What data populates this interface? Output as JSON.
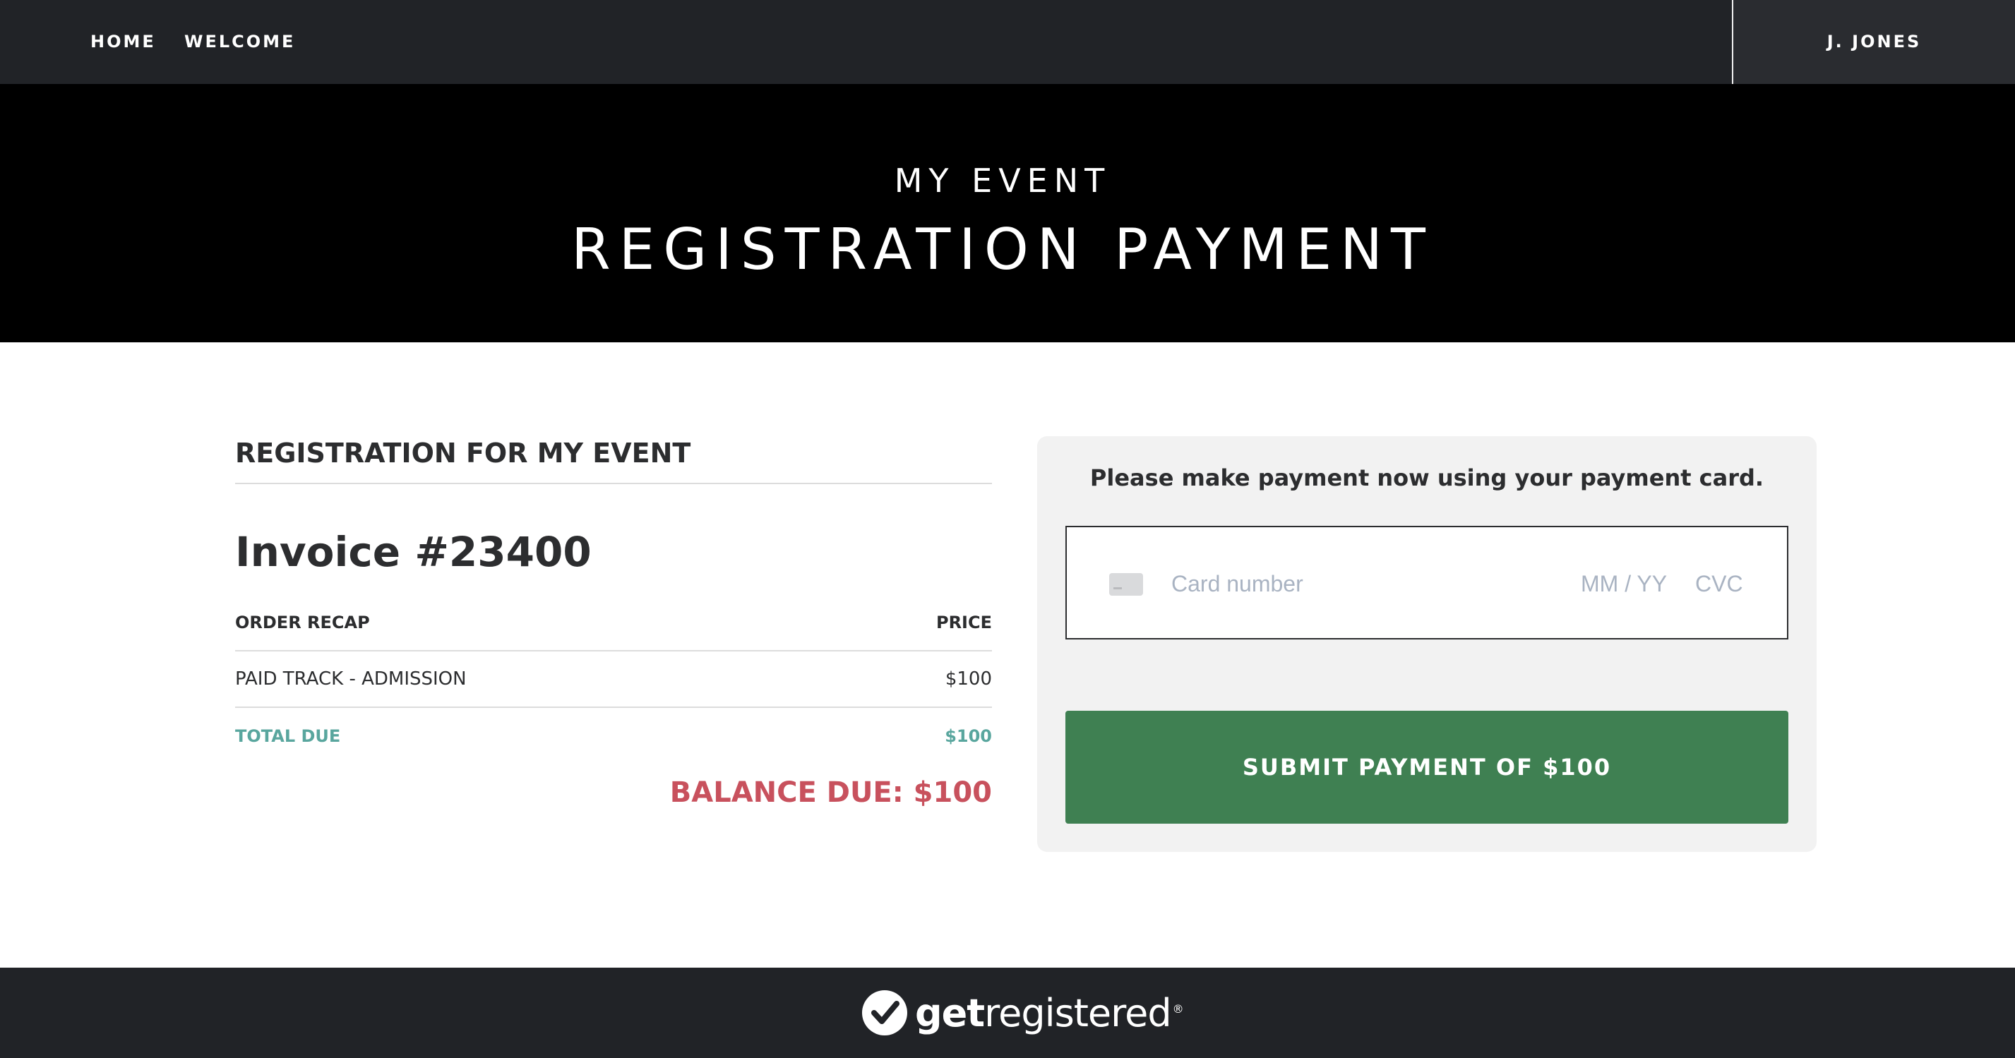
{
  "nav": {
    "home": "HOME",
    "welcome": "WELCOME",
    "user": "J. JONES"
  },
  "hero": {
    "subtitle": "MY EVENT",
    "title": "REGISTRATION PAYMENT"
  },
  "registration": {
    "heading": "REGISTRATION FOR MY EVENT",
    "invoice": "Invoice #23400",
    "columns": {
      "item": "ORDER RECAP",
      "price": "PRICE"
    },
    "items": [
      {
        "name": "PAID TRACK - ADMISSION",
        "price": "$100"
      }
    ],
    "total": {
      "label": "TOTAL DUE",
      "value": "$100"
    },
    "balance": "BALANCE DUE: $100"
  },
  "payment": {
    "message": "Please make payment now using your payment card.",
    "card_number_placeholder": "Card number",
    "expiry_placeholder": "MM / YY",
    "cvc_placeholder": "CVC",
    "submit_label": "SUBMIT PAYMENT OF $100"
  },
  "footer": {
    "logo_get": "get",
    "logo_registered": "registered",
    "logo_mark": "®"
  },
  "colors": {
    "nav_bg": "#212327",
    "hero_bg": "#000000",
    "total_teal": "#59a69e",
    "balance_red": "#c8515d",
    "submit_green": "#3f8052",
    "panel_bg": "#f2f2f2"
  },
  "icons": {
    "card": "credit-card-icon",
    "logo": "checkmark-circle-icon"
  }
}
